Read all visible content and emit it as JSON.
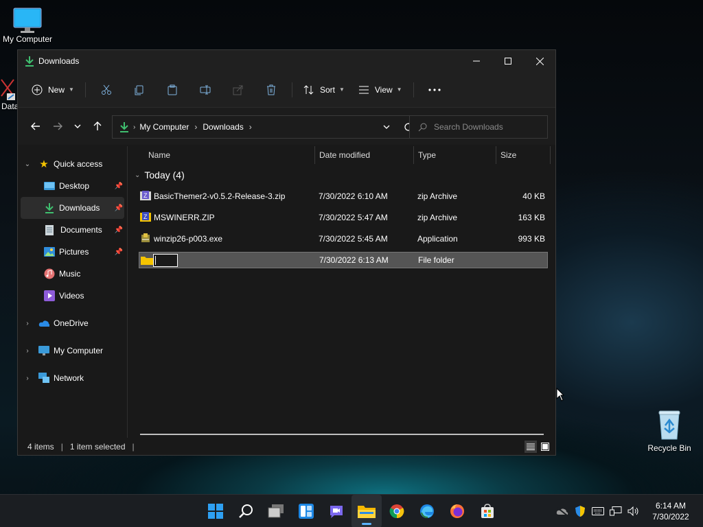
{
  "desktop": {
    "icons": [
      {
        "label": "My Computer"
      },
      {
        "label": "Data"
      },
      {
        "label": "Recycle Bin"
      }
    ]
  },
  "window": {
    "title": "Downloads",
    "toolbar": {
      "new_label": "New",
      "sort_label": "Sort",
      "view_label": "View"
    },
    "address": {
      "crumbs": [
        "My Computer",
        "Downloads"
      ]
    },
    "search": {
      "placeholder": "Search Downloads"
    },
    "sidebar": {
      "quick_access": "Quick access",
      "items": [
        {
          "label": "Desktop",
          "pinned": true
        },
        {
          "label": "Downloads",
          "pinned": true,
          "selected": true
        },
        {
          "label": "Documents",
          "pinned": true
        },
        {
          "label": "Pictures",
          "pinned": true
        },
        {
          "label": "Music"
        },
        {
          "label": "Videos"
        }
      ],
      "roots": [
        {
          "label": "OneDrive"
        },
        {
          "label": "My Computer"
        },
        {
          "label": "Network"
        }
      ]
    },
    "columns": {
      "name": "Name",
      "date": "Date modified",
      "type": "Type",
      "size": "Size"
    },
    "group_label": "Today (4)",
    "files": [
      {
        "name": "BasicThemer2-v0.5.2-Release-3.zip",
        "date": "7/30/2022 6:10 AM",
        "type": "zip Archive",
        "size": "40 KB",
        "icon": "zip-icon"
      },
      {
        "name": "MSWINERR.ZIP",
        "date": "7/30/2022 5:47 AM",
        "type": "zip Archive",
        "size": "163 KB",
        "icon": "zip-icon"
      },
      {
        "name": "winzip26-p003.exe",
        "date": "7/30/2022 5:45 AM",
        "type": "Application",
        "size": "993 KB",
        "icon": "installer-icon"
      },
      {
        "name": "",
        "date": "7/30/2022 6:13 AM",
        "type": "File folder",
        "size": "",
        "icon": "folder-icon",
        "renaming": true
      }
    ],
    "status": {
      "count": "4 items",
      "selection": "1 item selected"
    }
  },
  "taskbar": {
    "time": "6:14 AM",
    "date": "7/30/2022"
  }
}
